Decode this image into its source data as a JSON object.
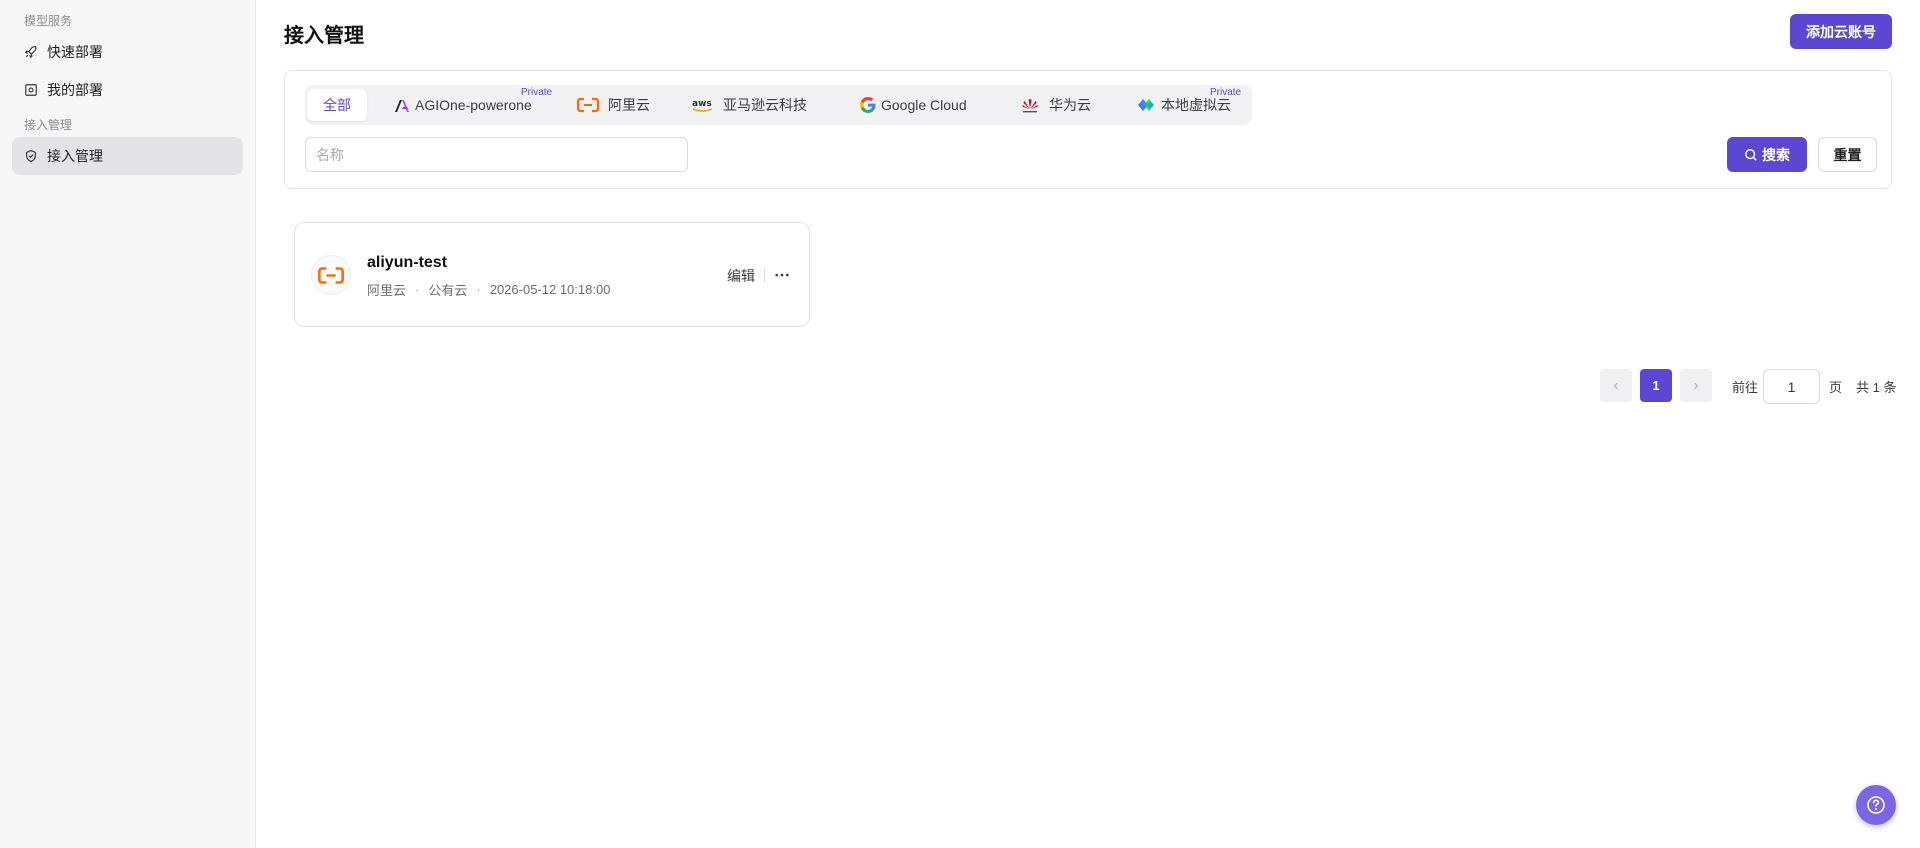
{
  "sidebar": {
    "groups": [
      {
        "label": "模型服务"
      },
      {
        "label": "接入管理"
      }
    ],
    "items": [
      {
        "label": "快速部署",
        "icon": "rocket-icon"
      },
      {
        "label": "我的部署",
        "icon": "deployment-icon"
      },
      {
        "label": "接入管理",
        "icon": "shield-check-icon",
        "active": true
      }
    ]
  },
  "header": {
    "title": "接入管理",
    "add_button": "添加云账号"
  },
  "filters": {
    "tabs": [
      {
        "label": "全部",
        "active": true
      },
      {
        "label": "AGIOne-powerone",
        "badge": "Private",
        "icon": "agione-logo-icon"
      },
      {
        "label": "阿里云",
        "icon": "aliyun-logo-icon"
      },
      {
        "label": "亚马逊云科技",
        "icon": "aws-logo-icon"
      },
      {
        "label": "Google Cloud",
        "icon": "google-logo-icon"
      },
      {
        "label": "华为云",
        "icon": "huawei-logo-icon"
      },
      {
        "label": "本地虚拟云",
        "badge": "Private",
        "icon": "local-cloud-icon"
      }
    ],
    "search_placeholder": "名称",
    "search_button": "搜索",
    "reset_button": "重置"
  },
  "cards": [
    {
      "name": "aliyun-test",
      "provider": "阿里云",
      "type": "公有云",
      "created": "2026-05-12 10:18:00",
      "edit_label": "编辑",
      "dot": "·"
    }
  ],
  "pagination": {
    "current": "1",
    "goto_label": "前往",
    "goto_value": "1",
    "page_unit": "页",
    "total": "共 1 条"
  },
  "colors": {
    "primary": "#5b47d1",
    "aliyun_orange": "#ff6a00"
  }
}
